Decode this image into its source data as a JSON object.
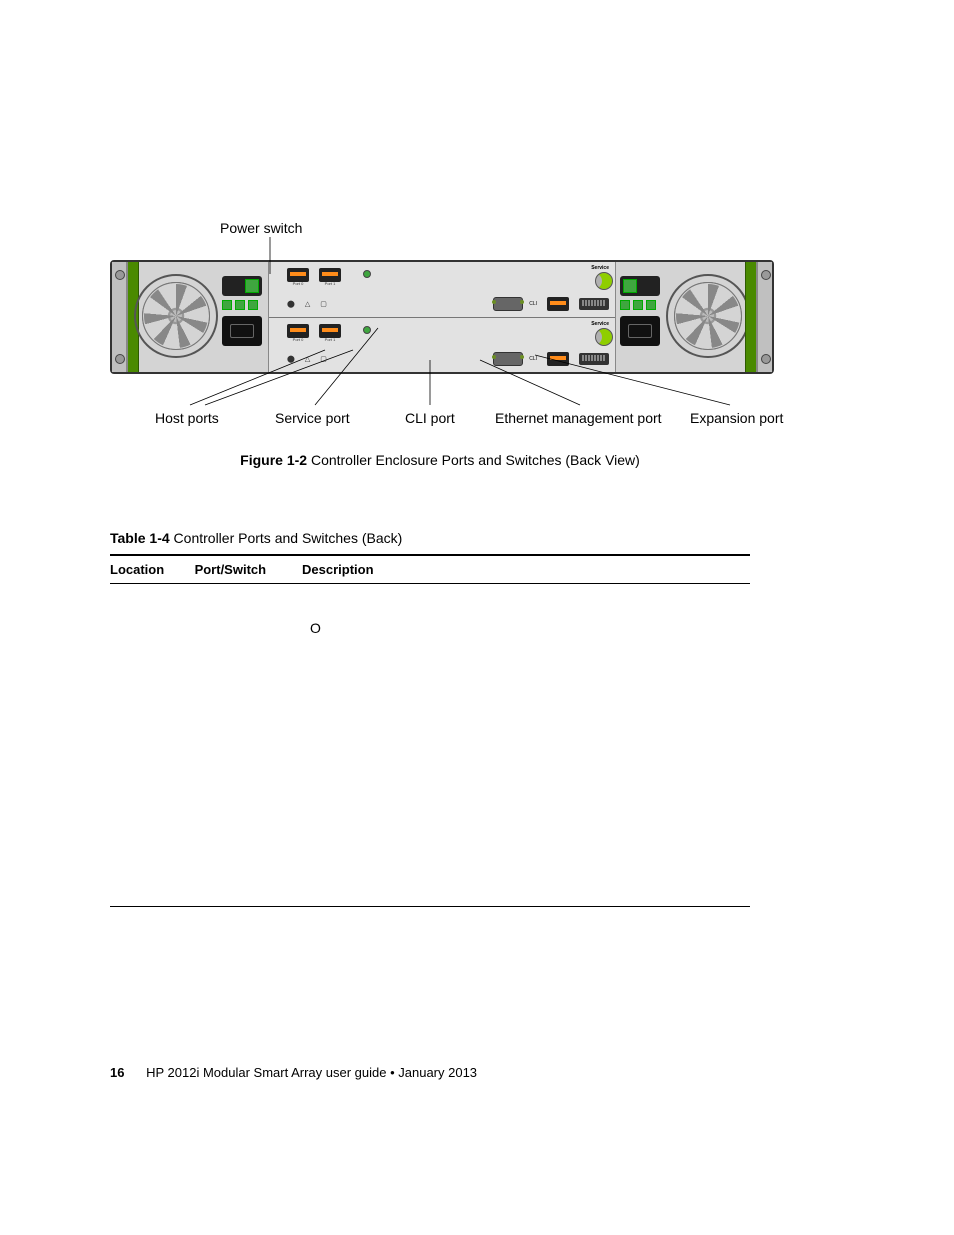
{
  "figure": {
    "top_label": "Power switch",
    "callouts": {
      "host_ports": "Host ports",
      "service_port": "Service port",
      "cli_port": "CLI port",
      "ethernet_mgmt": "Ethernet management port",
      "expansion_port": "Expansion port"
    },
    "module_labels": {
      "service": "Service",
      "cli": "CLI",
      "port0": "Port 0",
      "port1": "Port 1"
    },
    "caption_bold": "Figure 1-2",
    "caption_text": "  Controller Enclosure Ports and Switches (Back View)"
  },
  "table": {
    "caption_bold": "Table 1-4",
    "caption_text": " Controller Ports and Switches (Back)",
    "headers": {
      "location": "Location",
      "port_switch": "Port/Switch",
      "description": "Description"
    }
  },
  "stray": "O",
  "footer": {
    "page": "16",
    "text": "HP 2012i Modular Smart Array user guide • January 2013"
  }
}
